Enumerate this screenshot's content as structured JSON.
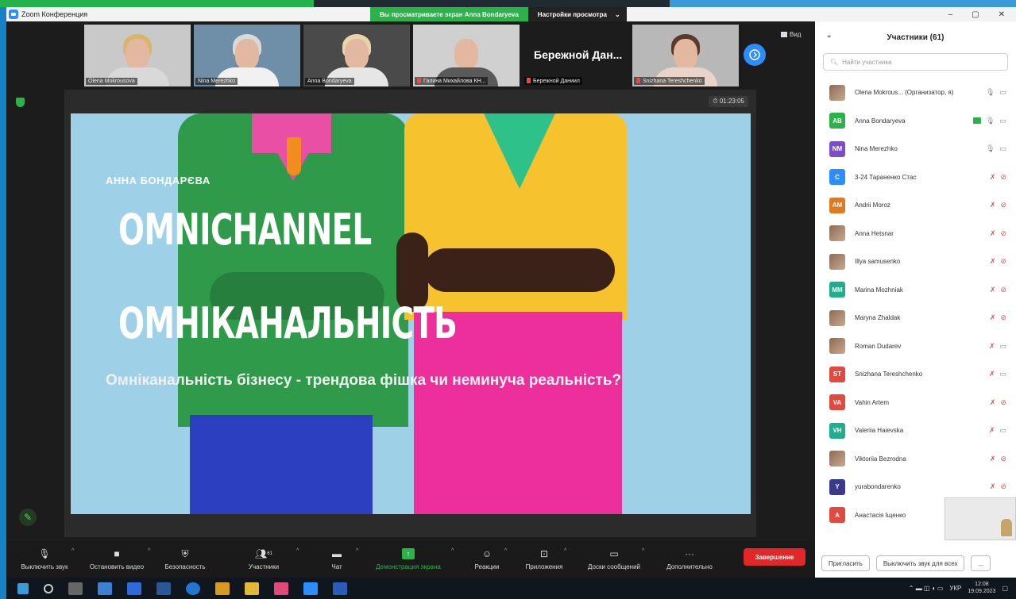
{
  "window": {
    "title": "Zoom Конференция",
    "share_banner": "Вы просматриваете экран Anna Bondaryeva",
    "view_options": "Настройки просмотра"
  },
  "gallery": {
    "view_label": "Вид",
    "tiles": [
      {
        "name": "Olena Mokrousova",
        "muted": false,
        "hair": "#d8b56a",
        "body": "#d9d9d9",
        "bg": "#c9c9c9"
      },
      {
        "name": "Nina Merezhko",
        "muted": false,
        "hair": "#d9d9d9",
        "body": "#f1f1f1",
        "bg": "#6f8fa8"
      },
      {
        "name": "Anna Bondaryeva",
        "muted": false,
        "hair": "#e8d6a8",
        "body": "#e6e6e6",
        "bg": "#4a4a4a"
      },
      {
        "name": "Галина Михайлова КН...",
        "muted": true,
        "hair": "#cfcfcf",
        "body": "#5a5a5a",
        "bg": "#d0d0d0"
      },
      {
        "name": "Бережной Даниил",
        "muted": true,
        "big_text": "Бережной Дан...",
        "text_only": true
      },
      {
        "name": "Snizhana Tereshchenko",
        "muted": true,
        "hair": "#5a3a2a",
        "body": "#e8d4c8",
        "bg": "#b8b8b8"
      }
    ]
  },
  "share": {
    "timer": "01:23:05",
    "slide": {
      "author": "АННА БОНДАРЄВА",
      "title_line1": "OMNICHANNEL",
      "title_line2": "ОМНІКАНАЛЬНІСТЬ",
      "subtitle": "Омніканальність бізнесу - трендова фішка чи неминуча реальність?"
    }
  },
  "toolbar": {
    "mute": "Выключить звук",
    "stop_video": "Остановить видео",
    "security": "Безопасность",
    "participants": "Участники",
    "participants_count": "61",
    "chat": "Чат",
    "share_screen": "Демонстрация экрана",
    "reactions": "Реакции",
    "apps": "Приложения",
    "whiteboards": "Доски сообщений",
    "more": "Дополнительно",
    "end": "Завершение"
  },
  "panel": {
    "title": "Участники (61)",
    "search_placeholder": "Найти участника",
    "participants": [
      {
        "name": "Olena Mokrous... (Организатор, я)",
        "initials": "",
        "color": "",
        "photo": true,
        "mic": "on",
        "cam": "on"
      },
      {
        "name": "Anna Bondaryeva",
        "initials": "AB",
        "color": "#2bb34a",
        "photo": false,
        "mic": "on",
        "cam": "on",
        "sharing": true
      },
      {
        "name": "Nina Merezhko",
        "initials": "NM",
        "color": "#7b4fc9",
        "photo": false,
        "mic": "on",
        "cam": "on"
      },
      {
        "name": "3-24 Тараненко Стас",
        "initials": "С",
        "color": "#2d8cff",
        "photo": false,
        "mic": "off",
        "cam": "off"
      },
      {
        "name": "Andrii Moroz",
        "initials": "AM",
        "color": "#e07a1f",
        "photo": false,
        "mic": "off",
        "cam": "off"
      },
      {
        "name": "Anna Hetsnar",
        "initials": "",
        "color": "",
        "photo": true,
        "mic": "off",
        "cam": "off"
      },
      {
        "name": "Illya samusenko",
        "initials": "",
        "color": "",
        "photo": true,
        "mic": "off",
        "cam": "off"
      },
      {
        "name": "Marina Mozhniak",
        "initials": "MM",
        "color": "#1fae8e",
        "photo": false,
        "mic": "off",
        "cam": "off"
      },
      {
        "name": "Maryna Zhaldak",
        "initials": "",
        "color": "",
        "photo": true,
        "mic": "off",
        "cam": "off"
      },
      {
        "name": "Roman Dudarev",
        "initials": "",
        "color": "",
        "photo": true,
        "mic": "off",
        "cam": "on"
      },
      {
        "name": "Snizhana Tereshchenko",
        "initials": "ST",
        "color": "#e04a3f",
        "photo": false,
        "mic": "off",
        "cam": "on"
      },
      {
        "name": "Vahin Artem",
        "initials": "VA",
        "color": "#e04a3f",
        "photo": false,
        "mic": "off",
        "cam": "off"
      },
      {
        "name": "Valeriia Haievska",
        "initials": "VH",
        "color": "#1fae8e",
        "photo": false,
        "mic": "off",
        "cam": "on"
      },
      {
        "name": "Viktoriia Bezrodna",
        "initials": "",
        "color": "",
        "photo": true,
        "mic": "off",
        "cam": "off"
      },
      {
        "name": "yurabondarenko",
        "initials": "Y",
        "color": "#3a3a8c",
        "photo": false,
        "mic": "off",
        "cam": "off"
      },
      {
        "name": "Анастасія Іщенко",
        "initials": "A",
        "color": "#e04a3f",
        "photo": false,
        "mic": "off",
        "cam": "off"
      }
    ],
    "invite": "Пригласить",
    "mute_all": "Выключить звук для всех",
    "more": "..."
  },
  "taskbar": {
    "lang": "УКР",
    "time": "12:08",
    "date": "19.09.2023"
  }
}
